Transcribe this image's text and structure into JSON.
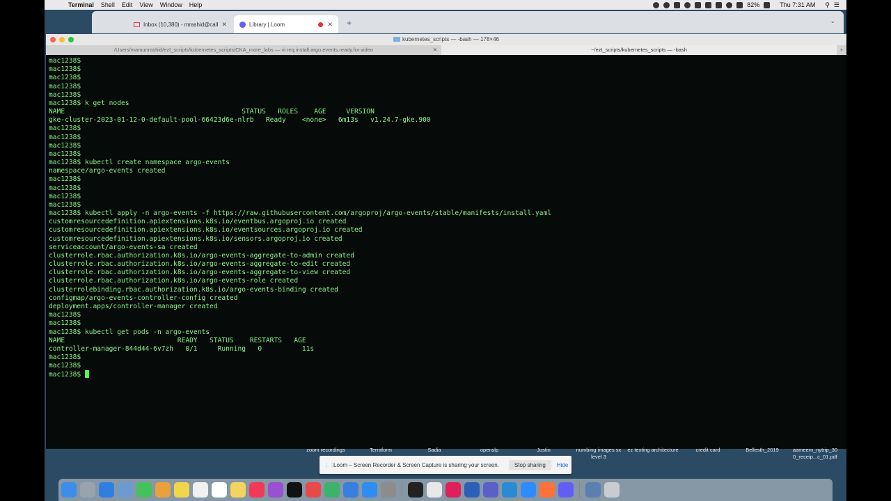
{
  "menubar": {
    "app_name": "Terminal",
    "menus": [
      "Shell",
      "Edit",
      "View",
      "Window",
      "Help"
    ],
    "battery": "82%",
    "clock": "Thu 7:31 AM"
  },
  "browser": {
    "tabs": [
      {
        "label": "Inbox (10,380) - mrashid@call",
        "icon": "gmail-icon"
      },
      {
        "label": "Library | Loom",
        "icon": "loom-icon"
      }
    ]
  },
  "terminal": {
    "window_title": "kubernetes_scripts — -bash — 178×46",
    "tabs": [
      "/Users/mamunrashid/ezt_scripts/kubernetes_scripts/CKA_more_labs — vi req.install.argo.events.ready.for.video",
      "~/ezt_scripts/kubernetes_scripts — -bash"
    ],
    "lines": [
      "mac1238$",
      "mac1238$",
      "mac1238$",
      "mac1238$",
      "mac1238$",
      "mac1238$ k get nodes",
      "NAME                                            STATUS   ROLES    AGE     VERSION",
      "gke-cluster-2023-01-12-0-default-pool-66423d6e-nlrb   Ready    <none>   6m13s   v1.24.7-gke.900",
      "mac1238$",
      "mac1238$",
      "mac1238$",
      "mac1238$",
      "mac1238$ kubectl create namespace argo-events",
      "namespace/argo-events created",
      "mac1238$",
      "mac1238$",
      "mac1238$",
      "mac1238$",
      "mac1238$ kubectl apply -n argo-events -f https://raw.githubusercontent.com/argoproj/argo-events/stable/manifests/install.yaml",
      "customresourcedefinition.apiextensions.k8s.io/eventbus.argoproj.io created",
      "customresourcedefinition.apiextensions.k8s.io/eventsources.argoproj.io created",
      "customresourcedefinition.apiextensions.k8s.io/sensors.argoproj.io created",
      "serviceaccount/argo-events-sa created",
      "clusterrole.rbac.authorization.k8s.io/argo-events-aggregate-to-admin created",
      "clusterrole.rbac.authorization.k8s.io/argo-events-aggregate-to-edit created",
      "clusterrole.rbac.authorization.k8s.io/argo-events-aggregate-to-view created",
      "clusterrole.rbac.authorization.k8s.io/argo-events-role created",
      "clusterrolebinding.rbac.authorization.k8s.io/argo-events-binding created",
      "configmap/argo-events-controller-config created",
      "deployment.apps/controller-manager created",
      "mac1238$",
      "mac1238$",
      "mac1238$ kubectl get pods -n argo-events",
      "NAME                            READY   STATUS    RESTARTS   AGE",
      "controller-manager-844d44-6v7zh   0/1     Running   0          11s",
      "mac1238$",
      "mac1238$"
    ],
    "prompt": "mac1238$ "
  },
  "desktop": {
    "labels": [
      "zoom recordings",
      "Terraform",
      "Sadia",
      "openslp",
      "Justin",
      "numbing images sx level 3",
      "ez texting architecture",
      "credit card",
      "Bellesth_2019",
      "aameem_nytrip_30 0_receip...c_01.pdf"
    ]
  },
  "loom_share": {
    "message": "Loom – Screen Recorder & Screen Capture is sharing your screen.",
    "stop_label": "Stop sharing",
    "hide_label": "Hide"
  },
  "dock": {
    "apps": [
      "finder-icon",
      "launchpad-icon",
      "safari-icon",
      "preview-icon",
      "messages-icon",
      "photos-icon",
      "notes-icon",
      "calendar-icon",
      "reminders-icon",
      "stickies-icon",
      "music-icon",
      "podcasts-icon",
      "tv-icon",
      "news-icon",
      "numbers-icon",
      "keynote-icon",
      "appstore-icon",
      "system-preferences-icon",
      "terminal-icon",
      "chrome-icon",
      "slack-icon",
      "word-icon",
      "teams-icon",
      "vscode-icon",
      "zoom-icon",
      "firefox-icon",
      "loom-icon",
      "downloads-folder-icon",
      "trash-icon"
    ]
  },
  "colors": {
    "terminal_bg": "#060a08",
    "terminal_text": "#8cf58c",
    "cursor": "#4cff4c",
    "desktop_bg": "#2b4a63"
  }
}
